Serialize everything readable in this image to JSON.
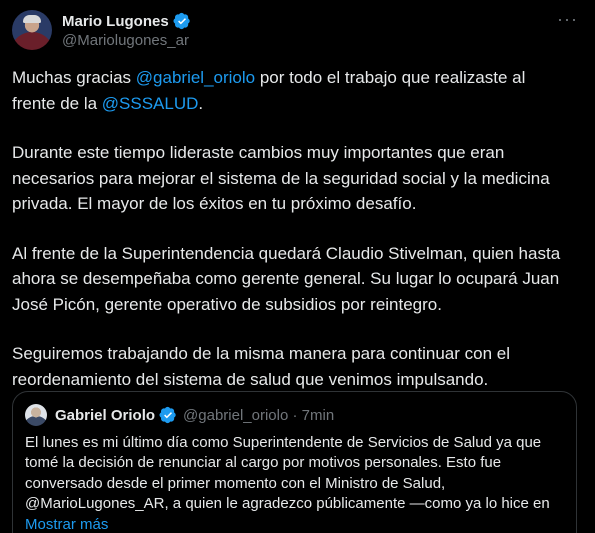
{
  "author": {
    "display_name": "Mario Lugones",
    "handle": "@Mariolugones_ar"
  },
  "menu": {
    "more_label": "···"
  },
  "tweet": {
    "p1_pre": "Muchas gracias ",
    "p1_mention1": "@gabriel_oriolo",
    "p1_mid": " por todo el trabajo que realizaste al frente de la ",
    "p1_mention2": "@SSSALUD",
    "p1_post": ".",
    "p2": "Durante este tiempo lideraste cambios muy importantes que eran necesarios para mejorar el sistema de la seguridad social y la medicina privada. El mayor de los éxitos en tu próximo desafío.",
    "p3": "Al frente de la Superintendencia quedará Claudio Stivelman, quien hasta ahora se desempeñaba como gerente general. Su lugar lo ocupará Juan José Picón, gerente operativo de subsidios por reintegro.",
    "p4": "Seguiremos trabajando de la misma manera para continuar con el reordenamiento del sistema de salud que venimos impulsando."
  },
  "quote": {
    "display_name": "Gabriel Oriolo",
    "handle_time": "@gabriel_oriolo · 7min",
    "text": "El lunes es mi último día como Superintendente de Servicios de Salud ya que tomé la decisión de renunciar al cargo por motivos personales. Esto fue conversado desde el primer momento con el Ministro de Salud, @MarioLugones_AR, a quien le agradezco públicamente —como ya lo hice en",
    "show_more": "Mostrar más"
  },
  "colors": {
    "background": "#000000",
    "text": "#e7e9ea",
    "secondary": "#71767b",
    "accent": "#1d9bf0",
    "border": "#2f3336"
  },
  "icons": {
    "verified": "verified-badge-icon",
    "more": "more-options-icon"
  }
}
